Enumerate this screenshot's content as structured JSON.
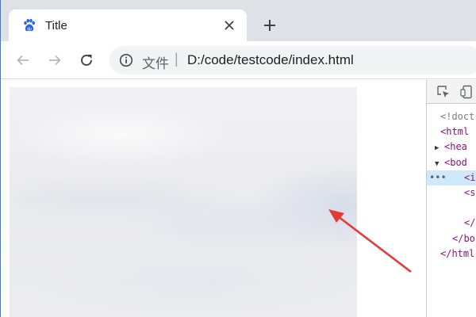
{
  "browser": {
    "tab": {
      "title": "Title",
      "favicon": "baidu-paw-icon"
    },
    "toolbar": {
      "back_icon": "arrow-left-icon",
      "forward_icon": "arrow-right-icon",
      "reload_icon": "reload-icon",
      "info_icon": "info-icon",
      "url_scheme_label": "文件",
      "url_separator": "|",
      "url": "D:/code/testcode/index.html"
    },
    "accent_color": "#1a73e8"
  },
  "page": {
    "image_description": "cloudy-sky-image",
    "annotation_arrow_color": "#e53935"
  },
  "devtools": {
    "toolbar_icons": [
      "inspect-element-icon",
      "device-toggle-icon"
    ],
    "elements": [
      {
        "text": "<!doct",
        "kind": "comment",
        "expander": ""
      },
      {
        "text": "<html",
        "kind": "tag",
        "expander": ""
      },
      {
        "text": "<hea",
        "kind": "tag",
        "expander": "▶"
      },
      {
        "text": "<bod",
        "kind": "tag",
        "expander": "▼"
      },
      {
        "text": "<i",
        "kind": "tag",
        "expander": "",
        "selected": true,
        "dots": "•••"
      },
      {
        "text": "<s",
        "kind": "tag",
        "expander": ""
      },
      {
        "text": "",
        "kind": "blank",
        "expander": ""
      },
      {
        "text": "</",
        "kind": "tag",
        "expander": ""
      },
      {
        "text": "</bo",
        "kind": "tag",
        "expander": ""
      },
      {
        "text": "</html",
        "kind": "tag",
        "expander": ""
      }
    ]
  }
}
